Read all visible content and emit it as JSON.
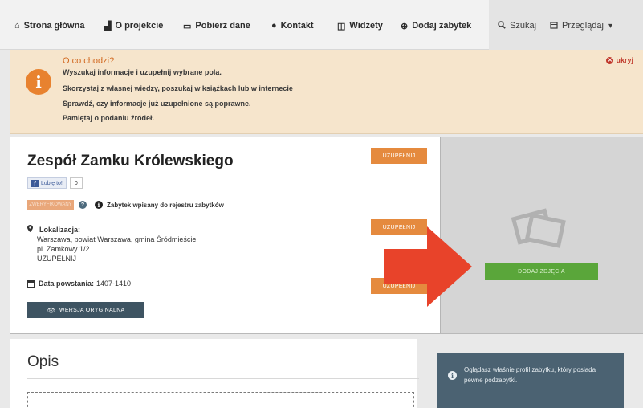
{
  "nav": {
    "items": [
      {
        "icon": "home-icon",
        "glyph": "⌂",
        "label": "Strona główna"
      },
      {
        "icon": "chart-icon",
        "glyph": "▟",
        "label": "O projekcie"
      },
      {
        "icon": "monitor-icon",
        "glyph": "▭",
        "label": "Pobierz dane"
      },
      {
        "icon": "chat-icon",
        "glyph": "●",
        "label": "Kontakt"
      },
      {
        "icon": "widget-icon",
        "glyph": "◫",
        "label": "Widżety"
      },
      {
        "icon": "plus-circle-icon",
        "glyph": "⊕",
        "label": "Dodaj zabytek"
      }
    ],
    "search_label": "Szukaj",
    "browse_label": "Przeglądaj",
    "browse_caret": "▾"
  },
  "banner": {
    "title": "O co chodzi?",
    "lines": [
      "Wyszukaj informacje i uzupełnij wybrane pola.",
      "Skorzystaj z własnej wiedzy, poszukaj w książkach lub w internecie",
      "Sprawdź, czy informacje już uzupełnione są poprawne.",
      "Pamiętaj o podaniu źródeł."
    ],
    "hide_label": "ukryj"
  },
  "monument": {
    "name": "Zespół Zamku Królewskiego",
    "fill_label": "UZUPEŁNIJ",
    "fb_like_label": "Lubię to!",
    "fb_count": "0",
    "status_badge": "ZWERYFIKOWANY",
    "register_text": "Zabytek wpisany do rejestru zabytków",
    "location_label": "Lokalizacja:",
    "location_lines": [
      "Warszawa, powiat Warszawa, gmina Śródmieście",
      "pl. Zamkowy 1/2",
      "UZUPEŁNIJ"
    ],
    "date_label": "Data powstania:",
    "date_value": "1407-1410",
    "original_version_label": "WERSJA ORYGINALNA"
  },
  "photo": {
    "add_label": "DODAJ ZDJĘCIA"
  },
  "description": {
    "title": "Opis"
  },
  "note": {
    "text": "Oglądasz właśnie profil zabytku, który posiada pewne podzabytki."
  },
  "colors": {
    "accent_orange": "#e58a3e",
    "highlight_red": "#e8432a",
    "add_green": "#5aa63a",
    "dark_slate": "#3e5462"
  }
}
